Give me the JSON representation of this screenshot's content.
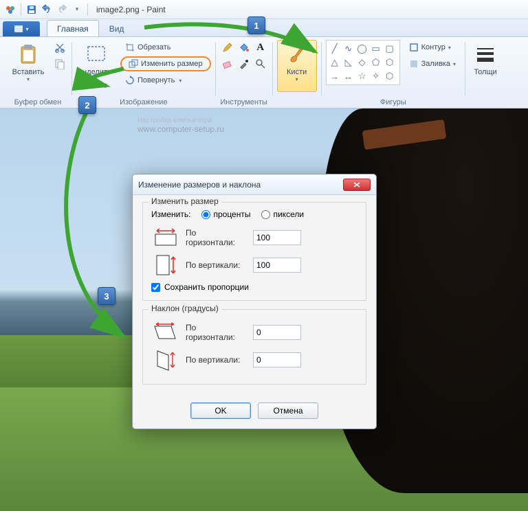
{
  "title": "image2.png - Paint",
  "tabs": {
    "main": "Главная",
    "view": "Вид"
  },
  "ribbon": {
    "clipboard": {
      "label": "Буфер обмен",
      "paste": "Вставить"
    },
    "image": {
      "label": "Изображение",
      "select_partial": "ыделить",
      "crop": "Обрезать",
      "resize": "Изменить размер",
      "rotate": "Повернуть"
    },
    "tools": {
      "label": "Инструменты"
    },
    "brushes": {
      "label": "Кисти"
    },
    "shapes": {
      "label": "Фигуры",
      "outline": "Контур",
      "fill": "Заливка"
    },
    "stroke": {
      "label": "Толщи"
    }
  },
  "watermark": {
    "line1": "Настройка компьютера",
    "line2": "www.computer-setup.ru"
  },
  "dialog": {
    "title": "Изменение размеров и наклона",
    "resize_legend": "Изменить размер",
    "by_label": "Изменить:",
    "percent": "проценты",
    "pixels": "пиксели",
    "h_label": "По горизонтали:",
    "v_label": "По вертикали:",
    "h_val": "100",
    "v_val": "100",
    "keep_ratio": "Сохранить пропорции",
    "skew_legend": "Наклон (градусы)",
    "skew_h": "0",
    "skew_v": "0",
    "ok": "OK",
    "cancel": "Отмена"
  },
  "callouts": {
    "c1": "1",
    "c2": "2",
    "c3": "3"
  }
}
